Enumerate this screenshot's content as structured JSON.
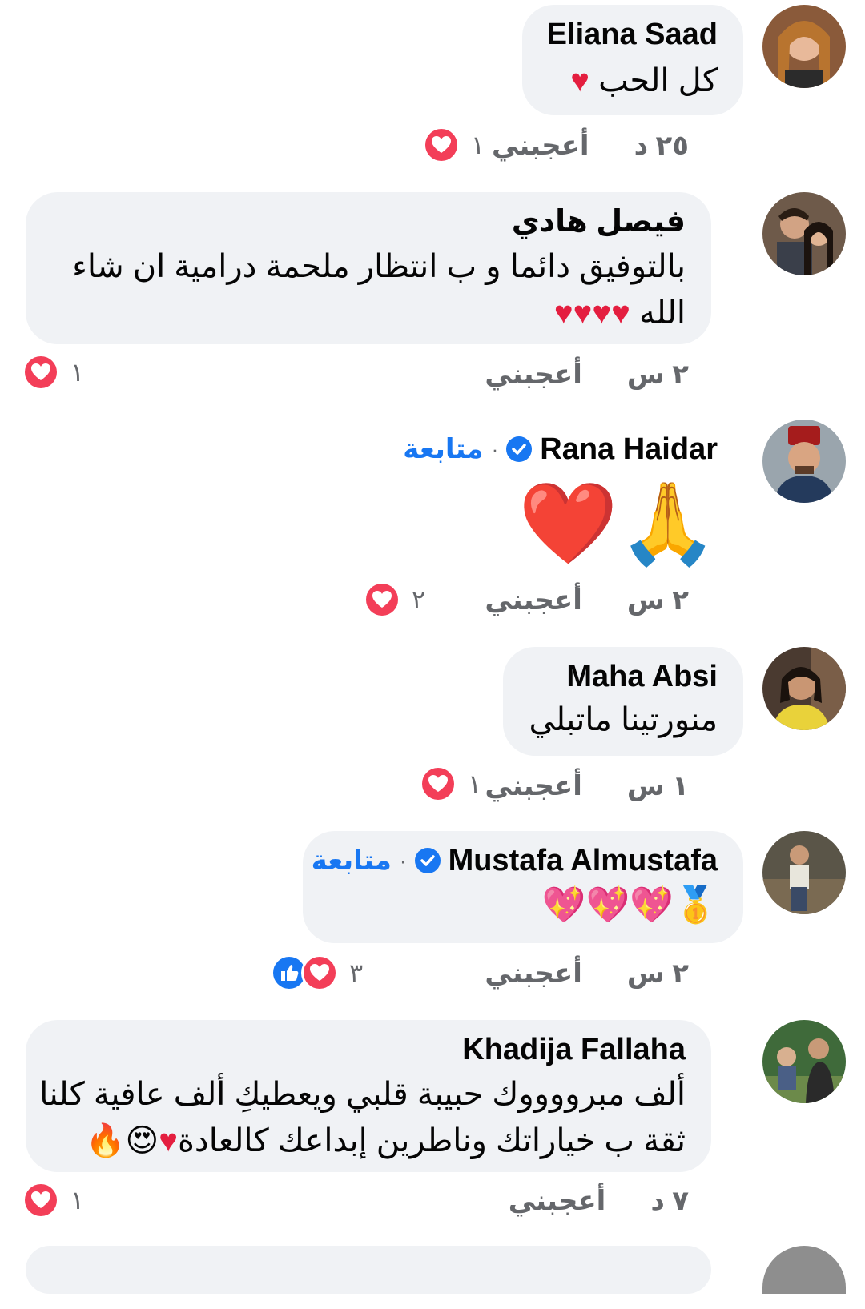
{
  "comments": [
    {
      "author": "Eliana Saad",
      "text_lines": [
        "كل الحب ♥"
      ],
      "time": "٢٥ د",
      "like_label": "أعجبني",
      "reaction_count": "١",
      "reactions": [
        "love"
      ]
    },
    {
      "author": "فيصل هادي",
      "text_lines": [
        "بالتوفيق دائما و ب انتظار ملحمة درامية ان شاء",
        "الله ♥♥♥♥"
      ],
      "time": "٢ س",
      "like_label": "أعجبني",
      "reaction_count": "١",
      "reactions": [
        "love"
      ]
    },
    {
      "author": "Rana Haidar",
      "verified": true,
      "follow_label": "متابعة",
      "text_lines": [
        "🙏❤️"
      ],
      "time": "٢ س",
      "like_label": "أعجبني",
      "reaction_count": "٢",
      "reactions": [
        "love"
      ]
    },
    {
      "author": "Maha Absi",
      "text_lines": [
        "منورتينا ماتبلي"
      ],
      "time": "١ س",
      "like_label": "أعجبني",
      "reaction_count": "١",
      "reactions": [
        "love"
      ]
    },
    {
      "author": "Mustafa Almustafa",
      "verified": true,
      "follow_label": "متابعة",
      "text_lines": [
        "🥇💖💖💖"
      ],
      "time": "٢ س",
      "like_label": "أعجبني",
      "reaction_count": "٣",
      "reactions": [
        "like",
        "love"
      ]
    },
    {
      "author": "Khadija Fallaha",
      "text_lines": [
        "ألف مبرووووك حبيبة قلبي ويعطيكِ ألف عافية كلنا",
        "ثقة ب خياراتك وناطرين إبداعك كالعادة♥😍🔥"
      ],
      "time": "٧ د",
      "like_label": "أعجبني",
      "reaction_count": "١",
      "reactions": [
        "love"
      ]
    }
  ],
  "icons": {
    "love_reaction": "heart-reaction-icon",
    "like_reaction": "thumbs-up-reaction-icon",
    "verified": "verified-badge-icon"
  },
  "colors": {
    "bubble": "#f0f2f5",
    "love": "#f33e58",
    "like": "#1877f2",
    "follow": "#1877f2",
    "meta": "#65676b"
  }
}
